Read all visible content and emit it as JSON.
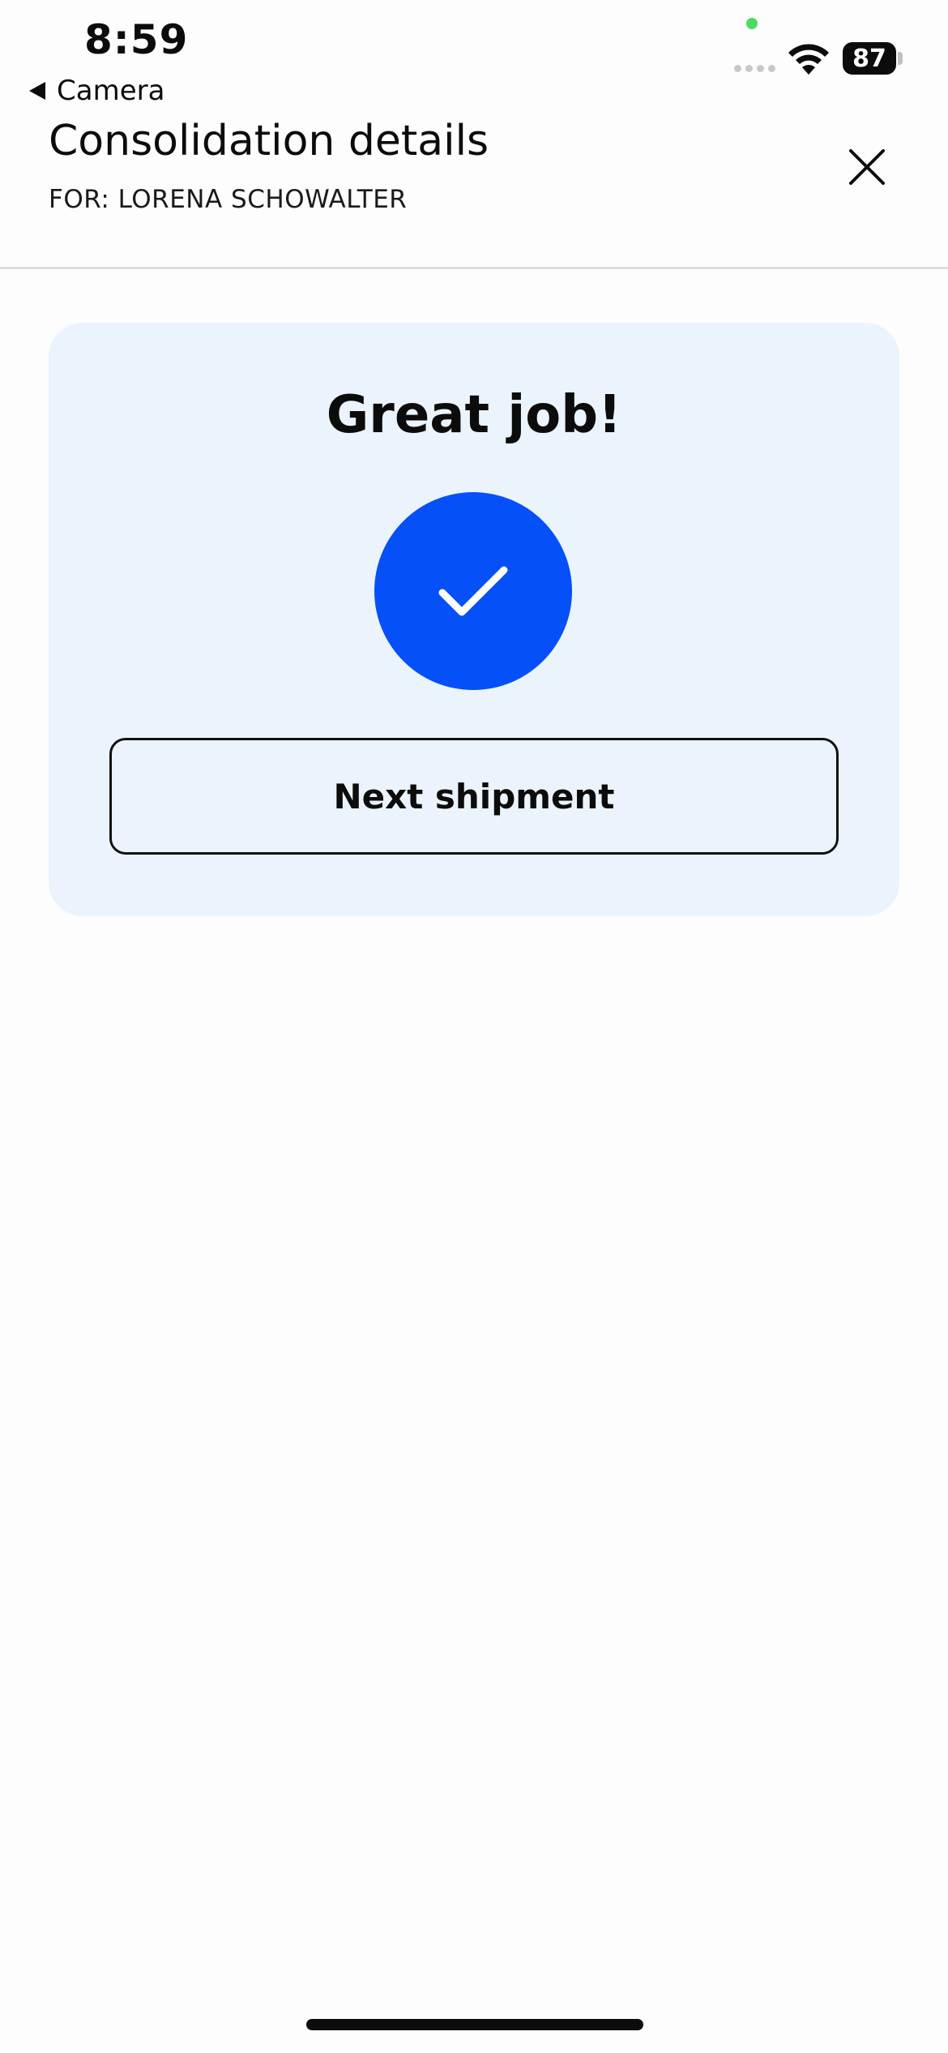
{
  "status_bar": {
    "time": "8:59",
    "battery_level": "87"
  },
  "navigation": {
    "back_label": "Camera"
  },
  "header": {
    "title": "Consolidation details",
    "subtitle": "FOR: LORENA SCHOWALTER"
  },
  "card": {
    "title": "Great job!",
    "button_label": "Next shipment"
  },
  "colors": {
    "accent": "#0550f8",
    "card_background": "#ebf4fc",
    "status_dot": "#4cd964"
  },
  "icons": {
    "close": "close-icon",
    "check": "checkmark-icon",
    "back": "back-triangle-icon",
    "wifi": "wifi-icon"
  }
}
